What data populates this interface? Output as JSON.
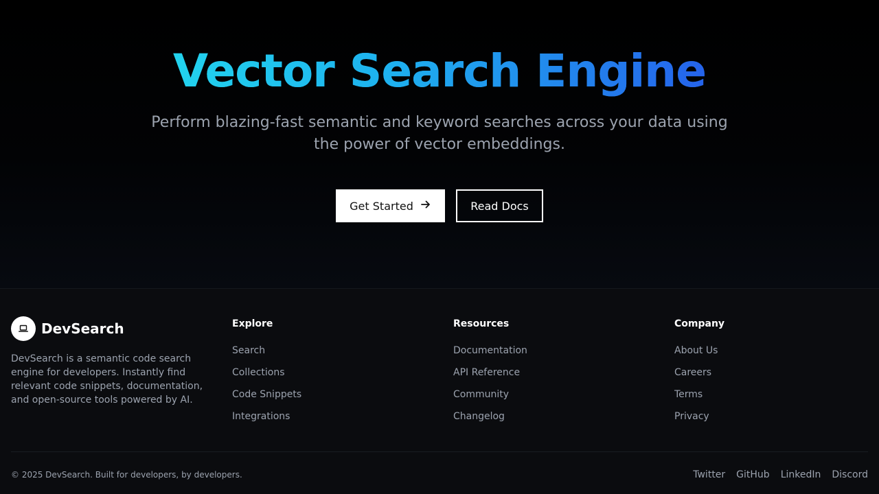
{
  "hero": {
    "title": "Vector Search Engine",
    "subtitle": "Perform blazing-fast semantic and keyword searches across your data using the power of vector embeddings.",
    "primary_button": "Get Started",
    "primary_button_icon": "arrow-right-icon",
    "secondary_button": "Read Docs",
    "title_gradient": [
      "#22d3ee",
      "#2563eb"
    ]
  },
  "footer": {
    "brand": {
      "name": "DevSearch",
      "logo_icon": "laptop-icon",
      "description": "DevSearch is a semantic code search engine for developers. Instantly find relevant code snippets, documentation, and open-source tools powered by AI."
    },
    "columns": [
      {
        "heading": "Explore",
        "links": [
          "Search",
          "Collections",
          "Code Snippets",
          "Integrations"
        ]
      },
      {
        "heading": "Resources",
        "links": [
          "Documentation",
          "API Reference",
          "Community",
          "Changelog"
        ]
      },
      {
        "heading": "Company",
        "links": [
          "About Us",
          "Careers",
          "Terms",
          "Privacy"
        ]
      }
    ],
    "copyright": "© 2025 DevSearch. Built for developers, by developers.",
    "social": [
      "Twitter",
      "GitHub",
      "LinkedIn",
      "Discord"
    ]
  }
}
